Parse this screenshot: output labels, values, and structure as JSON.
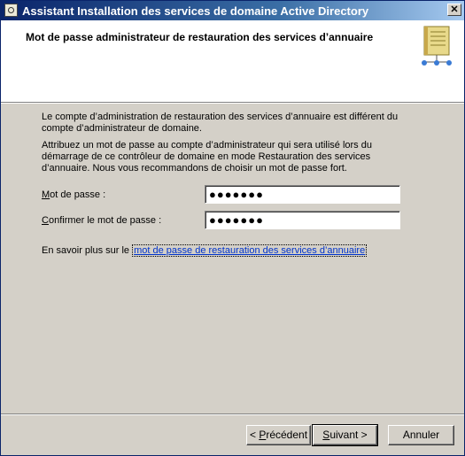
{
  "window": {
    "title": "Assistant Installation des services de domaine Active Directory",
    "close_label": "✕"
  },
  "header": {
    "title": "Mot de passe administrateur de restauration des services d’annuaire",
    "icon": "book-network-icon"
  },
  "content": {
    "para1": "Le compte d’administration de restauration des services d’annuaire est différent du compte d’administrateur de domaine.",
    "para2": "Attribuez un mot de passe au compte d’administrateur qui sera utilisé lors du démarrage de ce contrôleur de domaine en mode Restauration des services d’annuaire. Nous vous recommandons de choisir un mot de passe fort.",
    "password": {
      "label_first": "M",
      "label_rest": "ot de passe :",
      "value": "●●●●●●●"
    },
    "confirm": {
      "label_first": "C",
      "label_rest": "onfirmer le mot de passe :",
      "value": "●●●●●●●"
    },
    "learn_more_prefix": "En savoir plus sur le ",
    "learn_more_link": "mot de passe de restauration des services d’annuaire"
  },
  "buttons": {
    "back": {
      "pre": "< ",
      "key": "P",
      "rest": "récédent"
    },
    "next": {
      "key": "S",
      "rest": "uivant >"
    },
    "cancel": "Annuler"
  }
}
